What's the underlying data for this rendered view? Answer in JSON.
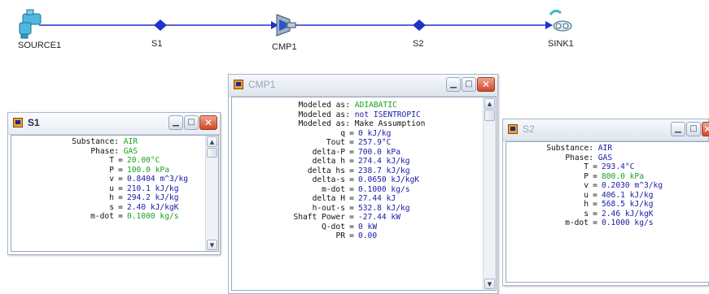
{
  "flowsheet": {
    "line_color": "#1e33c8",
    "nodes": [
      {
        "label": "SOURCE1",
        "icon": "faucet-source-icon"
      },
      {
        "label": "S1",
        "icon": "stream-node-icon"
      },
      {
        "label": "CMP1",
        "icon": "compressor-icon"
      },
      {
        "label": "S2",
        "icon": "stream-node-icon"
      },
      {
        "label": "SINK1",
        "icon": "sink-drain-icon"
      }
    ]
  },
  "windows": {
    "s1": {
      "title": "S1",
      "rows": [
        {
          "label": "Substance:",
          "value": "AIR",
          "color": "green"
        },
        {
          "label": "Phase:",
          "value": "GAS",
          "color": "green"
        },
        {
          "label": "T",
          "eq": "=",
          "value": "20.00°C",
          "color": "green"
        },
        {
          "label": "P",
          "eq": "=",
          "value": "100.0 kPa",
          "color": "green"
        },
        {
          "label": "v",
          "eq": "=",
          "value": "0.8404 m^3/kg",
          "color": "blue"
        },
        {
          "label": "u",
          "eq": "=",
          "value": "210.1 kJ/kg",
          "color": "blue"
        },
        {
          "label": "h",
          "eq": "=",
          "value": "294.2 kJ/kg",
          "color": "blue"
        },
        {
          "label": "s",
          "eq": "=",
          "value": "2.40 kJ/kgK",
          "color": "blue"
        },
        {
          "label": "m-dot",
          "eq": "=",
          "value": "0.1000 kg/s",
          "color": "green"
        }
      ]
    },
    "cmp1": {
      "title": "CMP1",
      "rows": [
        {
          "label": "Modeled as:",
          "value": "ADIABATIC",
          "color": "green"
        },
        {
          "label": "Modeled as:",
          "value": "not ISENTROPIC",
          "color": "blue"
        },
        {
          "label": "Modeled as:",
          "value": "Make Assumption",
          "color": "black"
        },
        {
          "label": "q",
          "eq": "=",
          "value": "0 kJ/kg",
          "color": "blue"
        },
        {
          "label": "Tout",
          "eq": "=",
          "value": "257.9°C",
          "color": "blue"
        },
        {
          "label": "delta-P",
          "eq": "=",
          "value": "700.0 kPa",
          "color": "blue"
        },
        {
          "label": "delta h",
          "eq": "=",
          "value": "274.4 kJ/kg",
          "color": "blue"
        },
        {
          "label": "delta hs",
          "eq": "=",
          "value": "238.7 kJ/kg",
          "color": "blue"
        },
        {
          "label": "delta-s",
          "eq": "=",
          "value": "0.0650 kJ/kgK",
          "color": "blue"
        },
        {
          "label": "m-dot",
          "eq": "=",
          "value": "0.1000 kg/s",
          "color": "blue"
        },
        {
          "label": "delta H",
          "eq": "=",
          "value": "27.44 kJ",
          "color": "blue"
        },
        {
          "label": "h-out-s",
          "eq": "=",
          "value": "532.8 kJ/kg",
          "color": "blue"
        },
        {
          "label": "Shaft Power",
          "eq": "=",
          "value": "-27.44 kW",
          "color": "blue"
        },
        {
          "label": "Q-dot",
          "eq": "=",
          "value": "0 kW",
          "color": "blue"
        },
        {
          "label": "PR",
          "eq": "=",
          "value": "0.00",
          "color": "blue"
        }
      ]
    },
    "s2": {
      "title": "S2",
      "rows": [
        {
          "label": "Substance:",
          "value": "AIR",
          "color": "blue"
        },
        {
          "label": "Phase:",
          "value": "GAS",
          "color": "blue"
        },
        {
          "label": "T",
          "eq": "=",
          "value": "293.4°C",
          "color": "blue"
        },
        {
          "label": "P",
          "eq": "=",
          "value": "800.0 kPa",
          "color": "green"
        },
        {
          "label": "v",
          "eq": "=",
          "value": "0.2030 m^3/kg",
          "color": "blue"
        },
        {
          "label": "u",
          "eq": "=",
          "value": "406.1 kJ/kg",
          "color": "blue"
        },
        {
          "label": "h",
          "eq": "=",
          "value": "568.5 kJ/kg",
          "color": "blue"
        },
        {
          "label": "s",
          "eq": "=",
          "value": "2.46 kJ/kgK",
          "color": "blue"
        },
        {
          "label": "m-dot",
          "eq": "=",
          "value": "0.1000 kg/s",
          "color": "blue"
        }
      ]
    }
  }
}
